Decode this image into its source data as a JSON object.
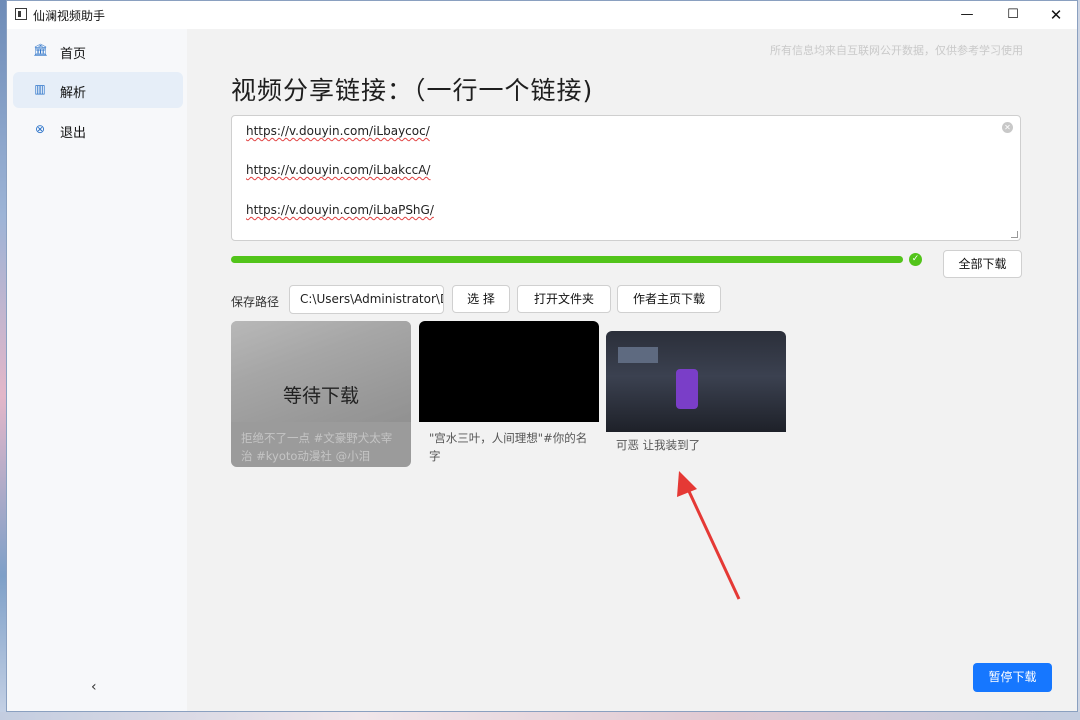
{
  "window": {
    "title": "仙澜视频助手"
  },
  "sidebar": {
    "items": [
      {
        "label": "首页",
        "icon": "bank-icon"
      },
      {
        "label": "解析",
        "icon": "board-icon",
        "active": true
      },
      {
        "label": "退出",
        "icon": "close-circle-icon"
      }
    ],
    "collapse_icon": "‹"
  },
  "main": {
    "notice": "所有信息均来自互联网公开数据，仅供参考学习使用",
    "title": "视频分享链接：（一行一个链接)",
    "urls": [
      "https://v.douyin.com/iLbaycoc/",
      "https://v.douyin.com/iLbakccA/",
      "https://v.douyin.com/iLbaPShG/"
    ],
    "progress": 100,
    "download_all_label": "全部下载",
    "path_label": "保存路径",
    "path_value": "C:\\Users\\Administrator\\D",
    "choose_label": "选 择",
    "open_folder_label": "打开文件夹",
    "author_download_label": "作者主页下载",
    "cards": [
      {
        "caption": "拒绝不了一点 #文豪野犬太宰治 #kyoto动漫社 @小泪",
        "status": "等待下载"
      },
      {
        "caption": "\"宫水三叶，人间理想\"#你的名字"
      },
      {
        "caption": "可恶 让我装到了"
      }
    ],
    "pause_label": "暂停下载"
  },
  "colors": {
    "accent": "#1677ff",
    "progress": "#52c41a",
    "arrow": "#e53935"
  }
}
